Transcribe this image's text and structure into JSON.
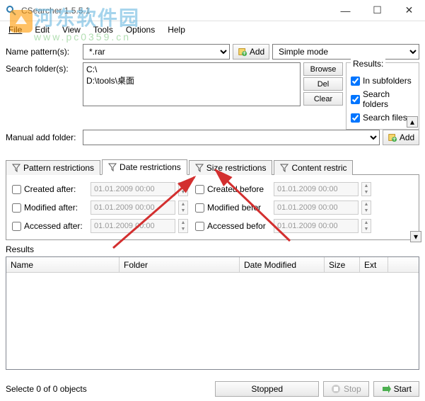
{
  "window": {
    "title": "CSearcher 1.5.5.1"
  },
  "menu": {
    "file": "File",
    "edit": "Edit",
    "view": "View",
    "tools": "Tools",
    "options": "Options",
    "help": "Help"
  },
  "labels": {
    "name_pattern": "Name pattern(s):",
    "search_folder": "Search folder(s):",
    "manual_add": "Manual add folder:",
    "add": "Add",
    "browse": "Browse",
    "del": "Del",
    "clear": "Clear",
    "simple_mode": "Simple mode",
    "results_legend": "Results:",
    "in_subfolders": "In subfolders",
    "search_folders": "Search folders",
    "search_files": "Search files"
  },
  "values": {
    "name_pattern": "*.rar",
    "folder1": "C:\\",
    "folder2": "D:\\tools\\桌面"
  },
  "tabs": {
    "pattern": "Pattern restrictions",
    "date": "Date restrictions",
    "size": "Size restrictions",
    "content": "Content restric"
  },
  "dates": {
    "created_after": "Created after:",
    "created_before": "Created before",
    "modified_after": "Modified after:",
    "modified_before": "Modified befor",
    "accessed_after": "Accessed after:",
    "accessed_before": "Accessed befor",
    "value": "01.01.2009 00:00"
  },
  "grid": {
    "results": "Results",
    "name": "Name",
    "folder": "Folder",
    "date_modified": "Date Modified",
    "size": "Size",
    "ext": "Ext"
  },
  "status": {
    "selected": "Selecte 0 of 0 objects",
    "stopped": "Stopped",
    "stop": "Stop",
    "start": "Start"
  },
  "watermark": {
    "cn": "河东软件园",
    "url": "www.pc0359.cn"
  }
}
